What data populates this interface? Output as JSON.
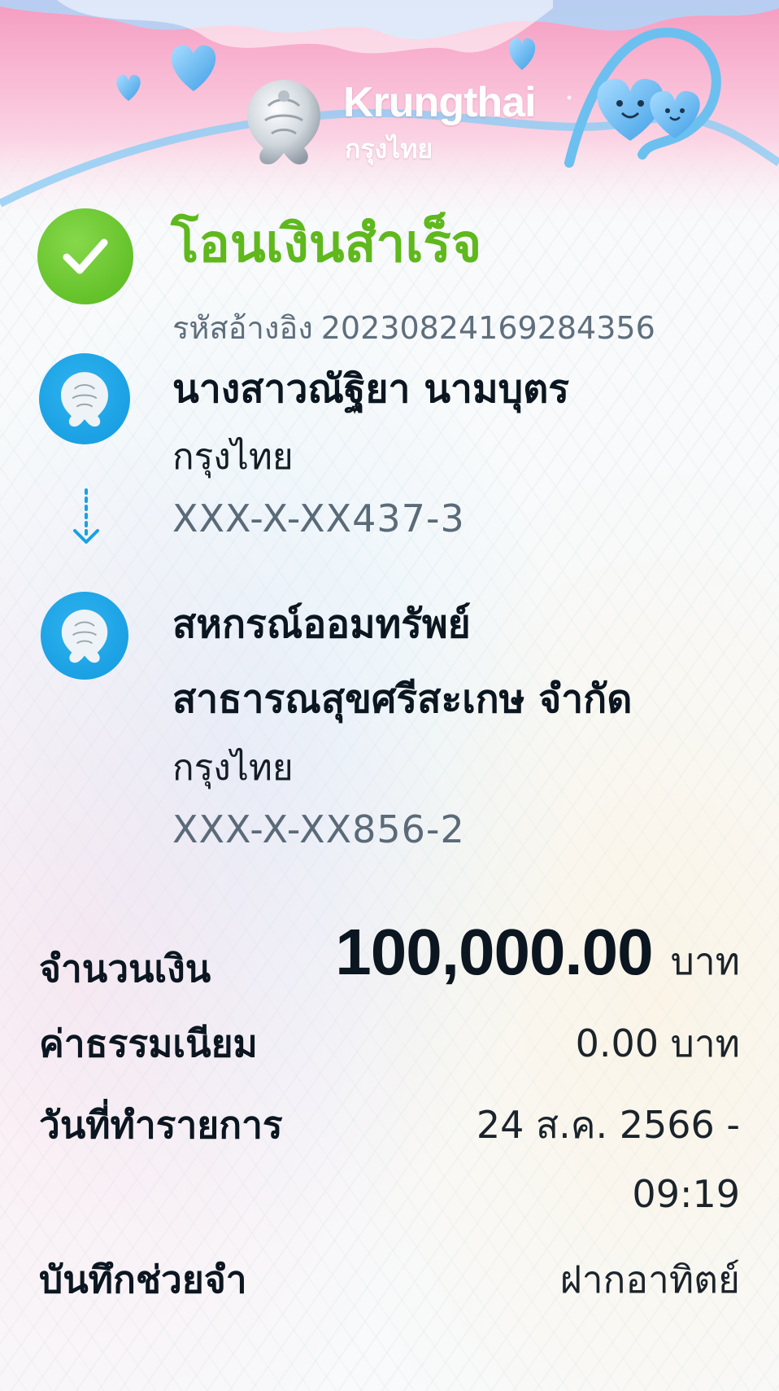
{
  "header": {
    "brand_name": "Krungthai",
    "brand_sub": "กรุงไทย"
  },
  "status": {
    "title": "โอนเงินสำเร็จ",
    "ref_label": "รหัสอ้างอิง",
    "ref_number": "20230824169284356"
  },
  "sender": {
    "name": "นางสาวณัฐิยา นามบุตร",
    "bank": "กรุงไทย",
    "account": "XXX-X-XX437-3"
  },
  "receiver": {
    "name_line1": "สหกรณ์ออมทรัพย์",
    "name_line2": "สาธารณสุขศรีสะเกษ จำกัด",
    "bank": "กรุงไทย",
    "account": "XXX-X-XX856-2"
  },
  "details": {
    "amount_label": "จำนวนเงิน",
    "amount_value": "100,000.00",
    "amount_unit": "บาท",
    "fee_label": "ค่าธรรมเนียม",
    "fee_value": "0.00 บาท",
    "date_label": "วันที่ทำรายการ",
    "date_line1": "24 ส.ค. 2566 -",
    "date_line2": "09:19",
    "memo_label": "บันทึกช่วยจำ",
    "memo_value": "ฝากอาทิตย์"
  },
  "colors": {
    "success_green": "#5fb81c",
    "bank_blue": "#129adf",
    "header_pink": "#f7a9c8",
    "ribbon_blue": "#6cc0ef"
  },
  "icons": {
    "success": "check-circle-icon",
    "bank": "krungthai-bird-icon",
    "transfer": "dotted-arrow-down-icon"
  }
}
